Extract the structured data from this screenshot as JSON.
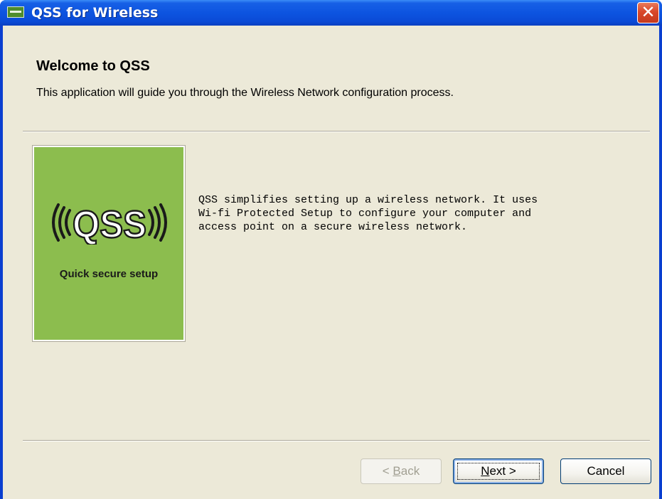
{
  "window": {
    "title": "QSS for Wireless",
    "close_glyph": "✕",
    "icon": "app-icon"
  },
  "header": {
    "title": "Welcome to QSS",
    "subtitle": "This application will guide you through the Wireless Network configuration process."
  },
  "logo": {
    "text": "QSS",
    "caption": "Quick secure setup",
    "color": "#8cbd4e"
  },
  "description": {
    "lines": [
      "QSS simplifies setting up a wireless network. It uses",
      "Wi-fi Protected Setup to configure your computer and",
      "access point on a secure wireless network."
    ]
  },
  "buttons": {
    "back_label_prefix": "< ",
    "back_label_mnemonic": "B",
    "back_label_rest": "ack",
    "back_enabled": false,
    "next_label_mnemonic": "N",
    "next_label_rest": "ext >",
    "cancel_label": "Cancel"
  },
  "colors": {
    "titlebar": "#0d54e0",
    "dialog_bg": "#ece9d8",
    "close_button": "#d9482a"
  }
}
